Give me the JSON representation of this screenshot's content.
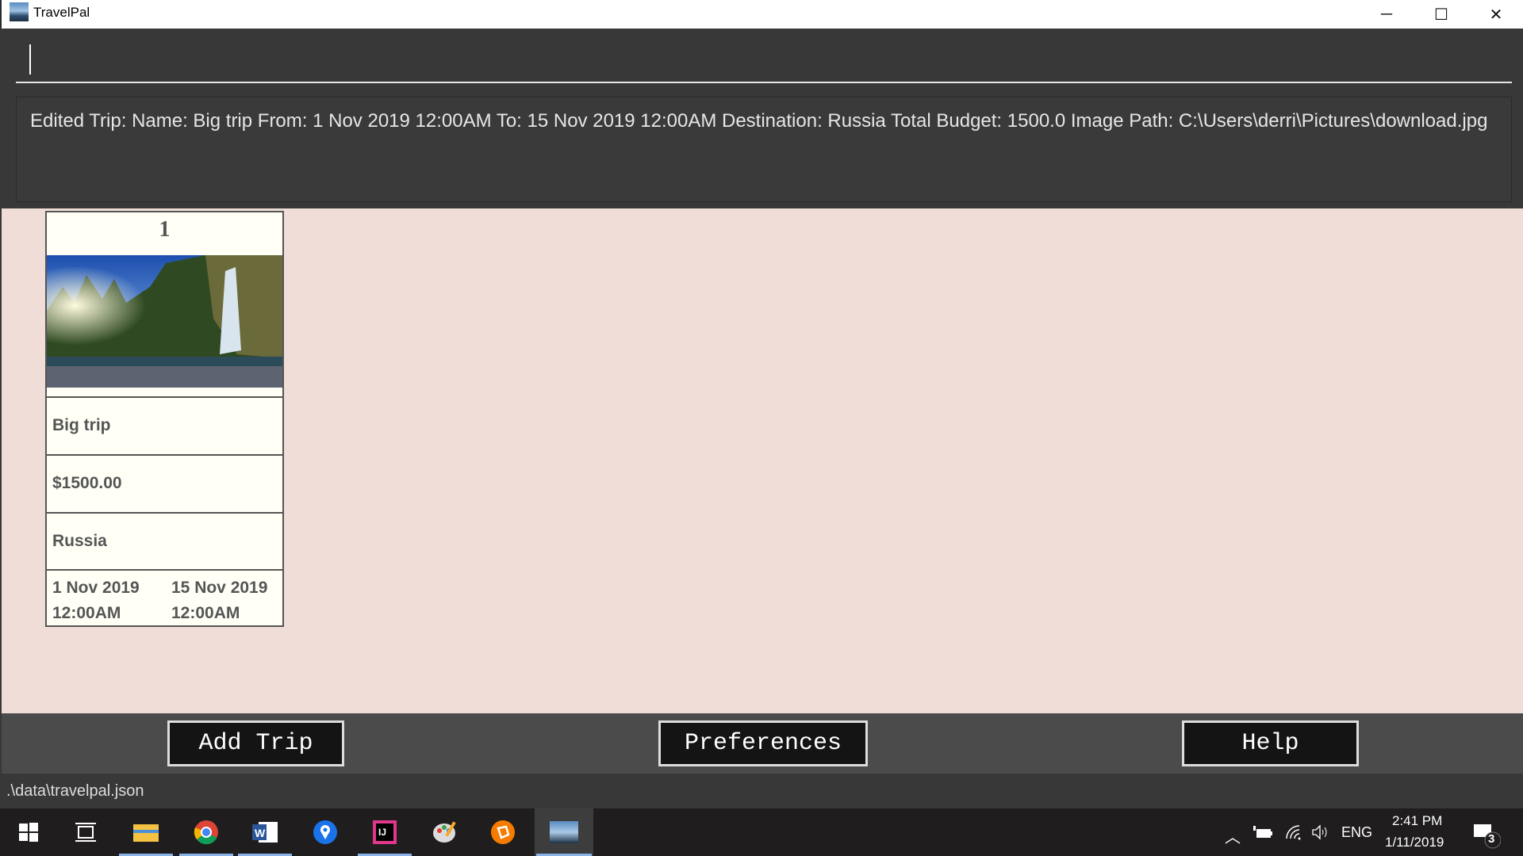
{
  "window": {
    "title": "TravelPal",
    "minimize": "─",
    "maximize": "☐",
    "close": "✕"
  },
  "command": {
    "value": ""
  },
  "result": {
    "text": "Edited Trip: Name: Big trip From: 1 Nov 2019 12:00AM To: 15 Nov 2019 12:00AM Destination: Russia Total Budget: 1500.0 Image Path: C:\\Users\\derri\\Pictures\\download.jpg"
  },
  "trips": [
    {
      "index": "1",
      "name": "Big trip",
      "budget": "$1500.00",
      "destination": "Russia",
      "from_date": "1 Nov 2019",
      "from_time": "12:00AM",
      "to_date": "15 Nov 2019",
      "to_time": "12:00AM"
    }
  ],
  "buttons": {
    "add_trip": "Add Trip",
    "preferences": "Preferences",
    "help": "Help"
  },
  "status": {
    "path": ".\\data\\travelpal.json"
  },
  "taskbar": {
    "language": "ENG",
    "time": "2:41 PM",
    "date": "1/11/2019",
    "notifications": "3"
  },
  "colors": {
    "main_bg": "#f0ddd7",
    "card_bg": "#fffff6",
    "dark_bg": "#383838",
    "button_bar": "#4b4b4b"
  }
}
